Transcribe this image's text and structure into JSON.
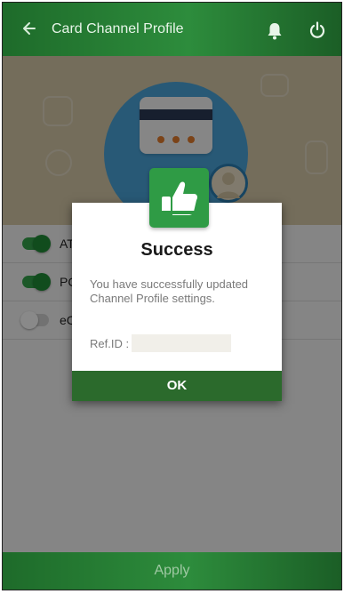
{
  "header": {
    "title": "Card Channel Profile",
    "back_icon": "arrow-left-icon",
    "bell_icon": "bell-icon",
    "power_icon": "power-icon",
    "color": "#2d8c3c"
  },
  "hero": {
    "illustration": "credit-card-with-user-icon",
    "card_color": "#f4f4f4",
    "circle_color": "#4aa3d8",
    "background_color": "#d3c6a7"
  },
  "channels": [
    {
      "label": "AT",
      "enabled": true
    },
    {
      "label": "PC",
      "enabled": true
    },
    {
      "label": "eC",
      "enabled": false
    }
  ],
  "footer": {
    "apply_label": "Apply"
  },
  "dialog": {
    "icon": "thumbs-up-icon",
    "title": "Success",
    "message": "You have successfully updated Channel Profile settings.",
    "ref_label": "Ref.ID :",
    "ref_value": "",
    "ok_label": "OK",
    "accent": "#2b6a2c"
  }
}
